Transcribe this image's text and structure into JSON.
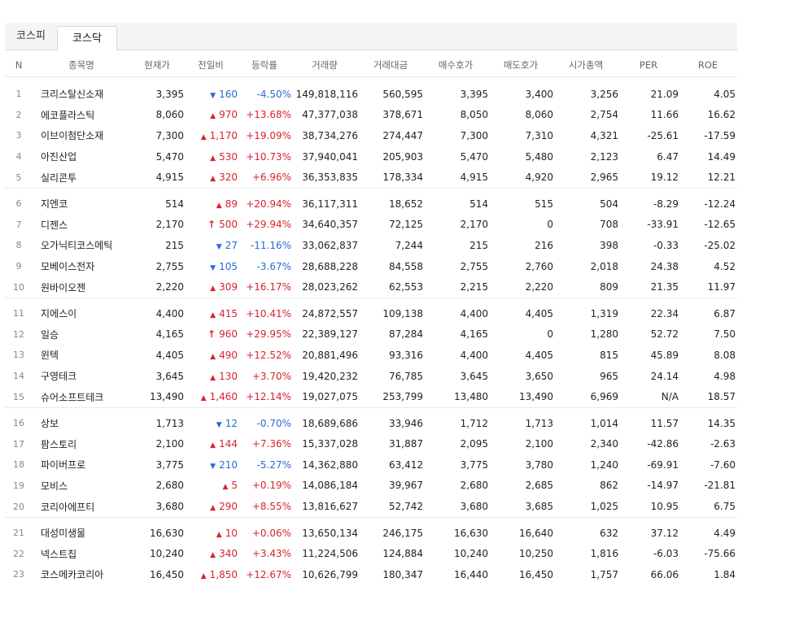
{
  "tabs": [
    {
      "label": "코스피",
      "active": false
    },
    {
      "label": "코스닥",
      "active": true
    }
  ],
  "columns": [
    "N",
    "종목명",
    "현재가",
    "전일비",
    "등락률",
    "거래량",
    "거래대금",
    "매수호가",
    "매도호가",
    "시가총액",
    "PER",
    "ROE"
  ],
  "colors": {
    "up": "#d6242c",
    "down": "#2a6ad2"
  },
  "rows": [
    [
      "1",
      "크리스탈신소재",
      "3,395",
      "▼",
      "160",
      "-4.50%",
      "149,818,116",
      "560,595",
      "3,395",
      "3,400",
      "3,256",
      "21.09",
      "4.05"
    ],
    [
      "2",
      "에코플라스틱",
      "8,060",
      "▲",
      "970",
      "+13.68%",
      "47,377,038",
      "378,671",
      "8,050",
      "8,060",
      "2,754",
      "11.66",
      "16.62"
    ],
    [
      "3",
      "이브이첨단소재",
      "7,300",
      "▲",
      "1,170",
      "+19.09%",
      "38,734,276",
      "274,447",
      "7,300",
      "7,310",
      "4,321",
      "-25.61",
      "-17.59"
    ],
    [
      "4",
      "아진산업",
      "5,470",
      "▲",
      "530",
      "+10.73%",
      "37,940,041",
      "205,903",
      "5,470",
      "5,480",
      "2,123",
      "6.47",
      "14.49"
    ],
    [
      "5",
      "실리콘투",
      "4,915",
      "▲",
      "320",
      "+6.96%",
      "36,353,835",
      "178,334",
      "4,915",
      "4,920",
      "2,965",
      "19.12",
      "12.21"
    ],
    [
      "6",
      "지엔코",
      "514",
      "▲",
      "89",
      "+20.94%",
      "36,117,311",
      "18,652",
      "514",
      "515",
      "504",
      "-8.29",
      "-12.24"
    ],
    [
      "7",
      "디젠스",
      "2,170",
      "↑",
      "500",
      "+29.94%",
      "34,640,357",
      "72,125",
      "2,170",
      "0",
      "708",
      "-33.91",
      "-12.65"
    ],
    [
      "8",
      "오가닉티코스메틱",
      "215",
      "▼",
      "27",
      "-11.16%",
      "33,062,837",
      "7,244",
      "215",
      "216",
      "398",
      "-0.33",
      "-25.02"
    ],
    [
      "9",
      "모베이스전자",
      "2,755",
      "▼",
      "105",
      "-3.67%",
      "28,688,228",
      "84,558",
      "2,755",
      "2,760",
      "2,018",
      "24.38",
      "4.52"
    ],
    [
      "10",
      "원바이오젠",
      "2,220",
      "▲",
      "309",
      "+16.17%",
      "28,023,262",
      "62,553",
      "2,215",
      "2,220",
      "809",
      "21.35",
      "11.97"
    ],
    [
      "11",
      "지에스이",
      "4,400",
      "▲",
      "415",
      "+10.41%",
      "24,872,557",
      "109,138",
      "4,400",
      "4,405",
      "1,319",
      "22.34",
      "6.87"
    ],
    [
      "12",
      "일승",
      "4,165",
      "↑",
      "960",
      "+29.95%",
      "22,389,127",
      "87,284",
      "4,165",
      "0",
      "1,280",
      "52.72",
      "7.50"
    ],
    [
      "13",
      "윈텍",
      "4,405",
      "▲",
      "490",
      "+12.52%",
      "20,881,496",
      "93,316",
      "4,400",
      "4,405",
      "815",
      "45.89",
      "8.08"
    ],
    [
      "14",
      "구영테크",
      "3,645",
      "▲",
      "130",
      "+3.70%",
      "19,420,232",
      "76,785",
      "3,645",
      "3,650",
      "965",
      "24.14",
      "4.98"
    ],
    [
      "15",
      "슈어소프트테크",
      "13,490",
      "▲",
      "1,460",
      "+12.14%",
      "19,027,075",
      "253,799",
      "13,480",
      "13,490",
      "6,969",
      "N/A",
      "18.57"
    ],
    [
      "16",
      "상보",
      "1,713",
      "▼",
      "12",
      "-0.70%",
      "18,689,686",
      "33,946",
      "1,712",
      "1,713",
      "1,014",
      "11.57",
      "14.35"
    ],
    [
      "17",
      "팜스토리",
      "2,100",
      "▲",
      "144",
      "+7.36%",
      "15,337,028",
      "31,887",
      "2,095",
      "2,100",
      "2,340",
      "-42.86",
      "-2.63"
    ],
    [
      "18",
      "파이버프로",
      "3,775",
      "▼",
      "210",
      "-5.27%",
      "14,362,880",
      "63,412",
      "3,775",
      "3,780",
      "1,240",
      "-69.91",
      "-7.60"
    ],
    [
      "19",
      "모비스",
      "2,680",
      "▲",
      "5",
      "+0.19%",
      "14,086,184",
      "39,967",
      "2,680",
      "2,685",
      "862",
      "-14.97",
      "-21.81"
    ],
    [
      "20",
      "코리아에프티",
      "3,680",
      "▲",
      "290",
      "+8.55%",
      "13,816,627",
      "52,742",
      "3,680",
      "3,685",
      "1,025",
      "10.95",
      "6.75"
    ],
    [
      "21",
      "대성미생물",
      "16,630",
      "▲",
      "10",
      "+0.06%",
      "13,650,134",
      "246,175",
      "16,630",
      "16,640",
      "632",
      "37.12",
      "4.49"
    ],
    [
      "22",
      "넥스트칩",
      "10,240",
      "▲",
      "340",
      "+3.43%",
      "11,224,506",
      "124,884",
      "10,240",
      "10,250",
      "1,816",
      "-6.03",
      "-75.66"
    ],
    [
      "23",
      "코스메카코리아",
      "16,450",
      "▲",
      "1,850",
      "+12.67%",
      "10,626,799",
      "180,347",
      "16,440",
      "16,450",
      "1,757",
      "66.06",
      "1.84"
    ]
  ]
}
